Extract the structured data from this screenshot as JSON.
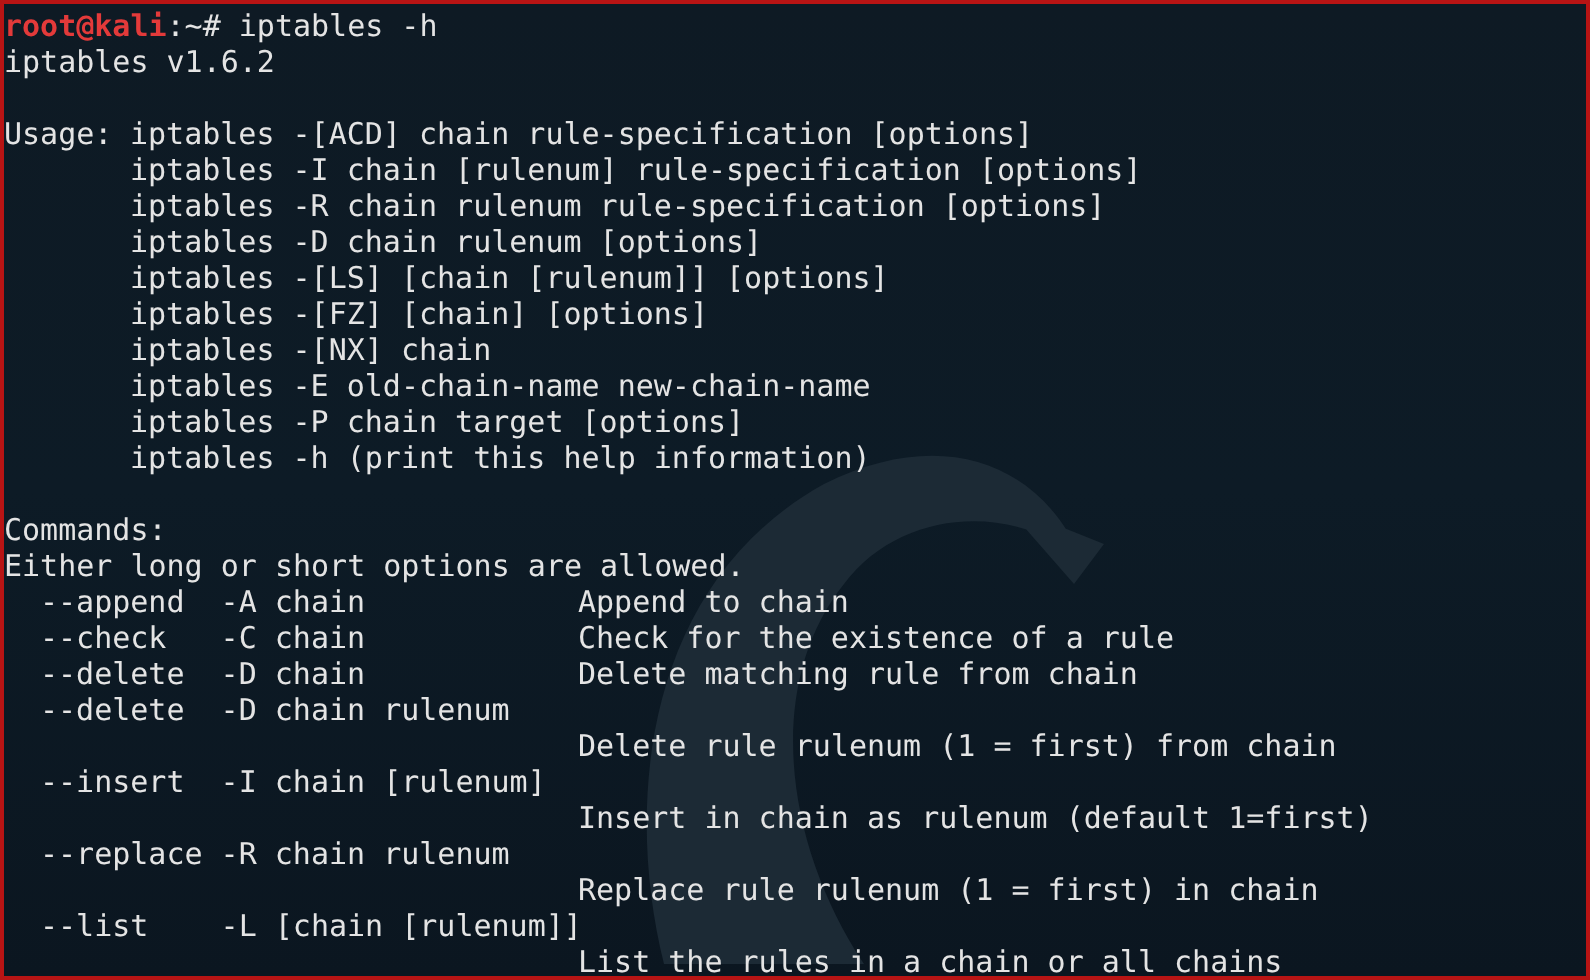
{
  "prompt": {
    "user_host": "root@kali",
    "path_symbol": ":~#",
    "command": "iptables -h"
  },
  "version": "iptables v1.6.2",
  "usage": {
    "label": "Usage:",
    "lines": [
      "iptables -[ACD] chain rule-specification [options]",
      "iptables -I chain [rulenum] rule-specification [options]",
      "iptables -R chain rulenum rule-specification [options]",
      "iptables -D chain rulenum [options]",
      "iptables -[LS] [chain [rulenum]] [options]",
      "iptables -[FZ] [chain] [options]",
      "iptables -[NX] chain",
      "iptables -E old-chain-name new-chain-name",
      "iptables -P chain target [options]",
      "iptables -h (print this help information)"
    ]
  },
  "commands_heading": "Commands:",
  "commands_note": "Either long or short options are allowed.",
  "commands": [
    {
      "option": "--append  -A chain",
      "description": "Append to chain"
    },
    {
      "option": "--check   -C chain",
      "description": "Check for the existence of a rule"
    },
    {
      "option": "--delete  -D chain",
      "description": "Delete matching rule from chain"
    },
    {
      "option": "--delete  -D chain rulenum"
    },
    {
      "description": "Delete rule rulenum (1 = first) from chain"
    },
    {
      "option": "--insert  -I chain [rulenum]"
    },
    {
      "description": "Insert in chain as rulenum (default 1=first)"
    },
    {
      "option": "--replace -R chain rulenum"
    },
    {
      "description": "Replace rule rulenum (1 = first) in chain"
    },
    {
      "option": "--list    -L [chain [rulenum]]"
    },
    {
      "description": "List the rules in a chain or all chains"
    }
  ]
}
